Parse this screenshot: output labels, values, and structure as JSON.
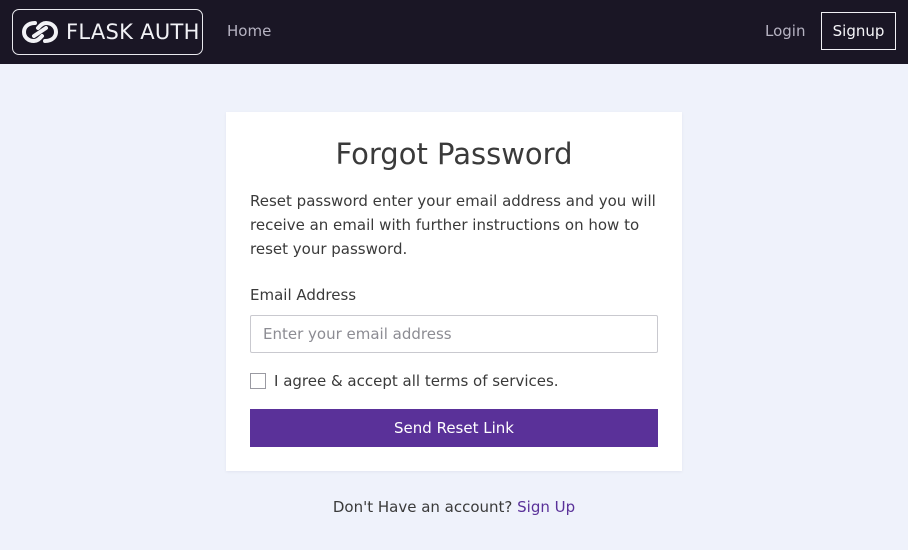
{
  "navbar": {
    "brand_text": "FLASK AUTH",
    "brand_icon": "infinity-link-icon",
    "home_label": "Home",
    "login_label": "Login",
    "signup_label": "Signup"
  },
  "form": {
    "title": "Forgot Password",
    "description": "Reset password enter your email address and you will receive an email with further instructions on how to reset your password.",
    "email_label": "Email Address",
    "email_placeholder": "Enter your email address",
    "email_value": "",
    "terms_label": "I agree & accept all terms of services.",
    "terms_checked": false,
    "submit_label": "Send Reset Link"
  },
  "footer": {
    "prompt": "Don't Have an account?",
    "signup_link": "Sign Up"
  },
  "colors": {
    "navbar_bg": "#1a1625",
    "page_bg": "#eff2fb",
    "accent": "#5a3199"
  }
}
